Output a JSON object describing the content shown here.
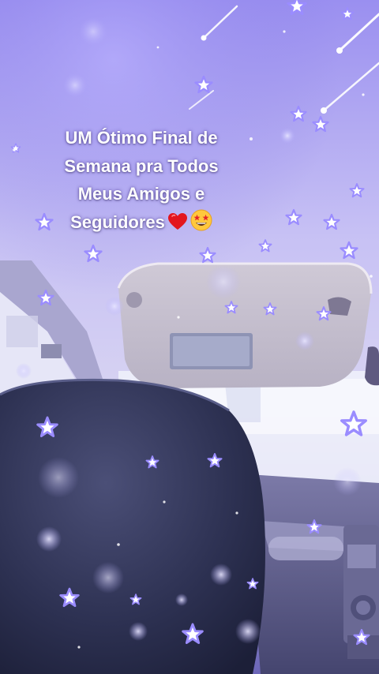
{
  "caption": {
    "lines": [
      "UM Ótimo Final de",
      "Semana pra Todos",
      "Meus Amigos e",
      "Seguidores"
    ],
    "emoji": [
      "red-heart",
      "star-struck-face"
    ]
  },
  "colors": {
    "overlay_purple": "#8a7cff",
    "sky_lavender": "#c9c4ff",
    "seat_dark": "#2b2f4e",
    "heart_red": "#e3161e",
    "emoji_yellow": "#ffc83d"
  }
}
